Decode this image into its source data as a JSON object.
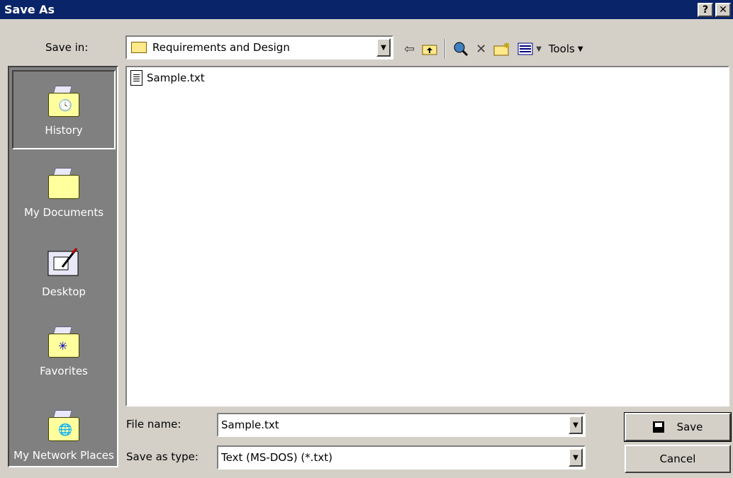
{
  "window": {
    "title": "Save As",
    "help_label": "?",
    "close_label": "✕"
  },
  "save_in": {
    "label": "Save in:",
    "value": "Requirements and Design"
  },
  "toolbar": {
    "back_icon": "back-arrow-icon",
    "up_icon": "up-folder-icon",
    "search_icon": "search-web-icon",
    "delete_icon": "delete-icon",
    "new_folder_icon": "new-folder-icon",
    "views_icon": "views-icon",
    "tools_label": "Tools"
  },
  "places": [
    {
      "label": "History",
      "icon": "history-icon",
      "mark": "🕓",
      "selected": true
    },
    {
      "label": "My Documents",
      "icon": "my-documents-icon",
      "mark": "",
      "selected": false
    },
    {
      "label": "Desktop",
      "icon": "desktop-icon",
      "mark": "",
      "selected": false
    },
    {
      "label": "Favorites",
      "icon": "favorites-icon",
      "mark": "✳",
      "selected": false
    },
    {
      "label": "My Network Places",
      "icon": "network-places-icon",
      "mark": "🌐",
      "selected": false
    }
  ],
  "files": [
    {
      "name": "Sample.txt",
      "icon": "text-file-icon"
    }
  ],
  "file_name": {
    "label": "File name:",
    "value": "Sample.txt"
  },
  "save_as_type": {
    "label": "Save as type:",
    "value": "Text (MS-DOS) (*.txt)"
  },
  "buttons": {
    "save": "Save",
    "cancel": "Cancel"
  },
  "colors": {
    "titlebar": "#0a246a",
    "dialog": "#d4d0c8",
    "places_bg": "#808080"
  }
}
